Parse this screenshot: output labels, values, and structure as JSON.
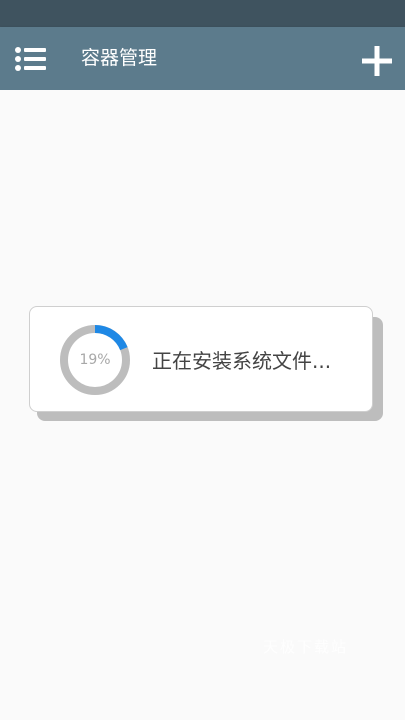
{
  "app_bar": {
    "title": "容器管理",
    "menu_icon": "menu-list-icon",
    "add_icon": "plus-icon",
    "background": "#5c7b8c"
  },
  "status_bar": {
    "background": "#3f535f"
  },
  "install_dialog": {
    "progress_percent": 19,
    "progress_label": "19%",
    "message": "正在安装系统文件...",
    "ring_color": "#bdbdbd",
    "progress_color": "#1e88e5"
  },
  "watermark": {
    "text": "天极下载站"
  }
}
